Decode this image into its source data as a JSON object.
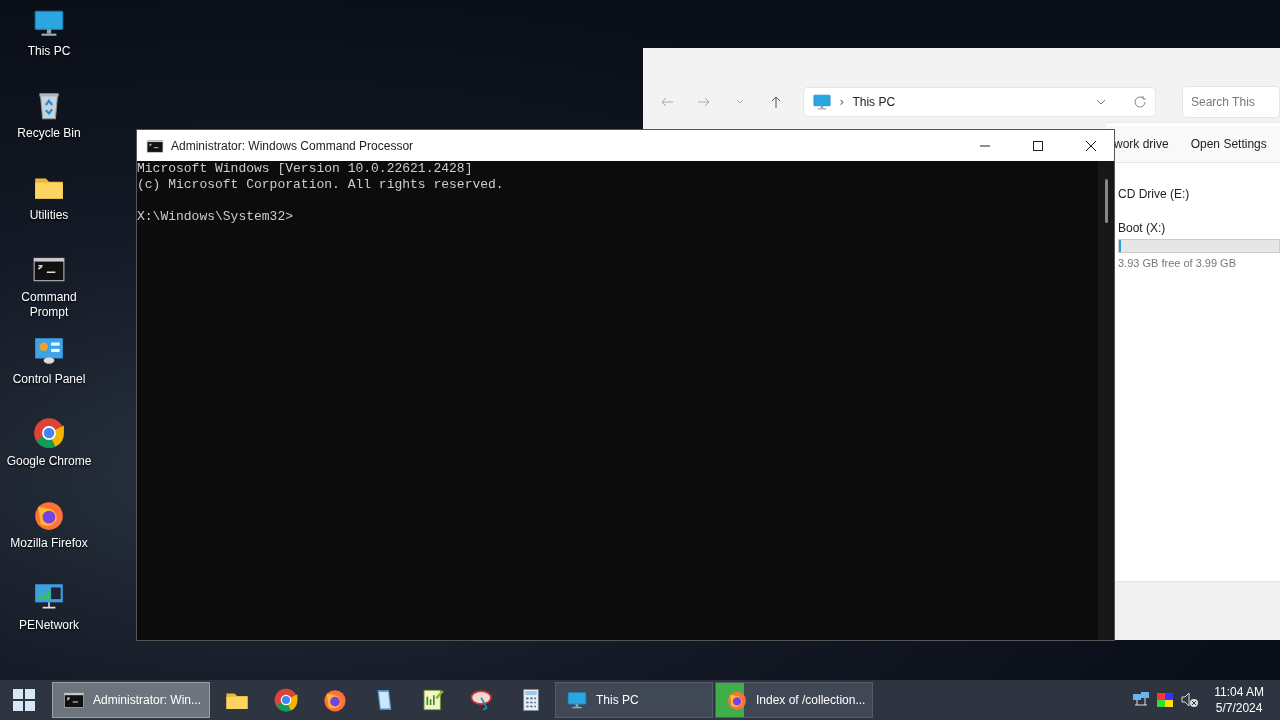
{
  "desktop_icons": [
    {
      "kind": "pc",
      "label": "This PC"
    },
    {
      "kind": "bin",
      "label": "Recycle Bin"
    },
    {
      "kind": "folder",
      "label": "Utilities"
    },
    {
      "kind": "cmd",
      "label": "Command Prompt"
    },
    {
      "kind": "panel",
      "label": "Control Panel"
    },
    {
      "kind": "chrome",
      "label": "Google Chrome"
    },
    {
      "kind": "firefox",
      "label": "Mozilla Firefox"
    },
    {
      "kind": "network",
      "label": "PENetwork"
    }
  ],
  "explorer": {
    "separator": "›",
    "address": "This PC",
    "search_placeholder": "Search This",
    "commands": [
      "work drive",
      "Open Settings"
    ],
    "drives": [
      {
        "name": "CD Drive (E:)"
      },
      {
        "name": "Boot (X:)",
        "level": 0.015,
        "free": "3.93 GB free of 3.99 GB"
      }
    ]
  },
  "console": {
    "title": "Administrator: Windows Command Processor",
    "lines": [
      "Microsoft Windows [Version 10.0.22621.2428]",
      "(c) Microsoft Corporation. All rights reserved."
    ],
    "prompt": "X:\\Windows\\System32>"
  },
  "taskbar": {
    "items": [
      {
        "kind": "cmd",
        "label": "Administrator: Win...",
        "selected": true
      },
      {
        "kind": "folder"
      },
      {
        "kind": "chrome"
      },
      {
        "kind": "firefox"
      },
      {
        "kind": "notepad"
      },
      {
        "kind": "editor"
      },
      {
        "kind": "dish"
      },
      {
        "kind": "calc"
      },
      {
        "kind": "pc",
        "label": "This PC",
        "selected": false
      },
      {
        "kind": "firefox",
        "label": "Index of /collection...",
        "selected": false,
        "level": 0.18
      }
    ],
    "time": "11:04 AM",
    "date": "5/7/2024"
  }
}
